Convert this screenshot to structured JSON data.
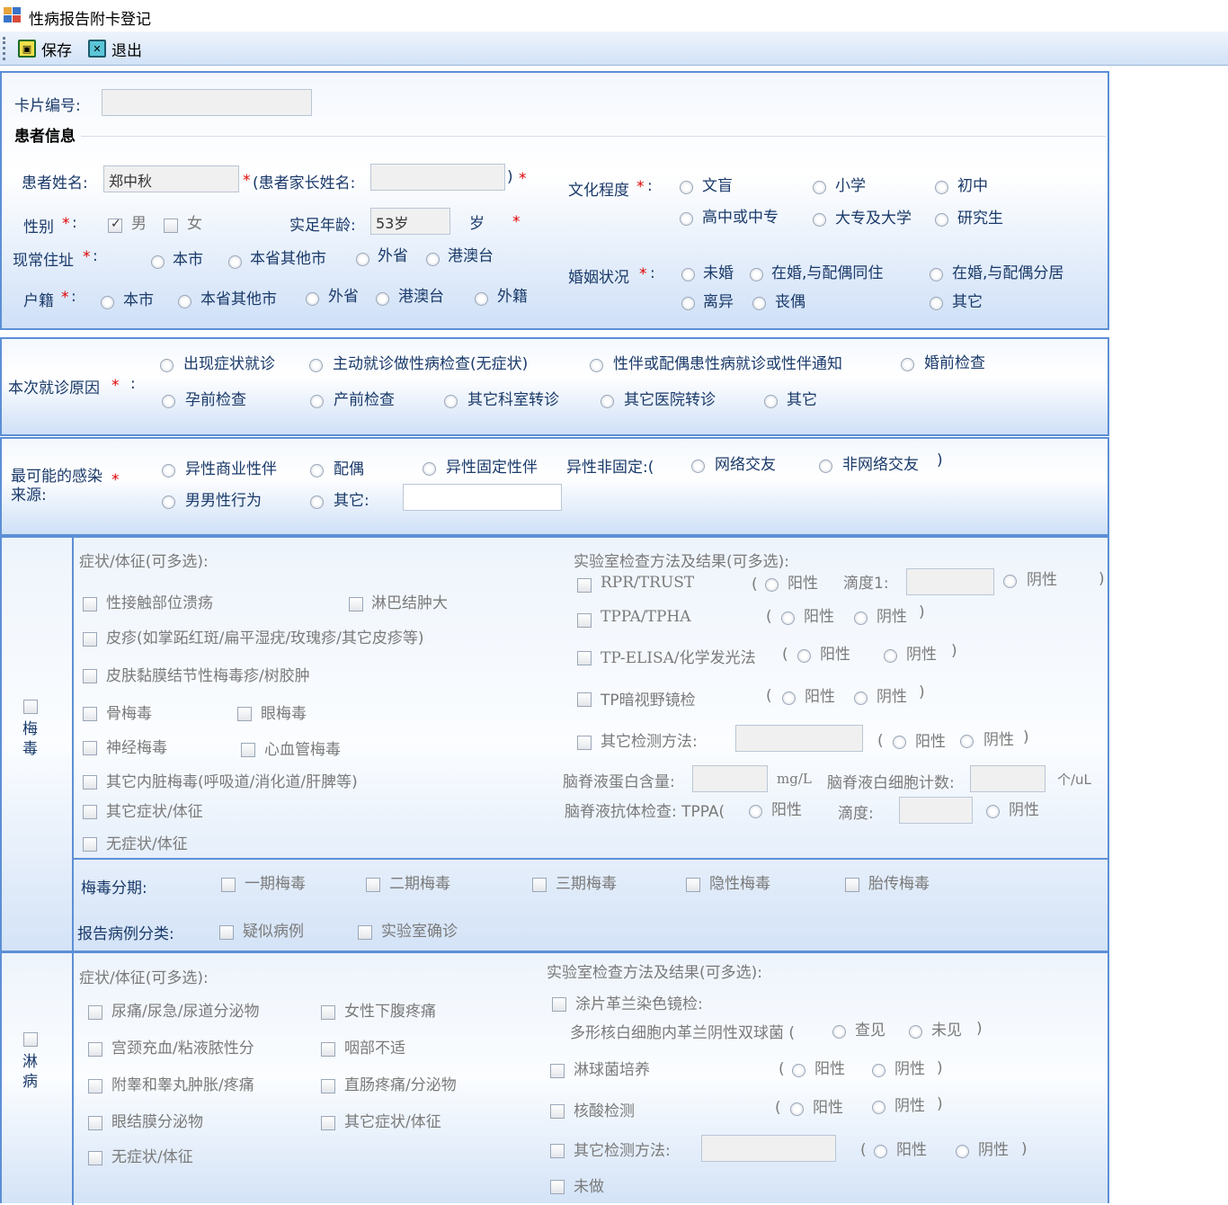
{
  "window": {
    "title": "性病报告附卡登记"
  },
  "toolbar": {
    "save": "保存",
    "exit": "退出"
  },
  "card": {
    "label": "卡片编号:",
    "value": ""
  },
  "patient": {
    "section": "患者信息",
    "name_label": "患者姓名:",
    "name_value": "郑中秋",
    "star": "*",
    "parent_label": "(患者家长姓名:",
    "parent_value": "",
    "paren_close": ")",
    "sex_label": "性别",
    "sex_male": "男",
    "sex_female": "女",
    "age_label": "实足年龄:",
    "age_value": "53岁",
    "age_unit": "岁",
    "edu_label": "文化程度",
    "colon": ":",
    "edu_opts": [
      "文盲",
      "小学",
      "初中",
      "高中或中专",
      "大专及大学",
      "研究生"
    ],
    "addr_label": "现常住址",
    "addr_opts": [
      "本市",
      "本省其他市",
      "外省",
      "港澳台"
    ],
    "reg_label": "户籍",
    "reg_opts": [
      "本市",
      "本省其他市",
      "外省",
      "港澳台",
      "外籍"
    ],
    "marry_label": "婚姻状况",
    "marry_opts": [
      "未婚",
      "在婚,与配偶同住",
      "在婚,与配偶分居",
      "离异",
      "丧偶",
      "其它"
    ]
  },
  "visit": {
    "label": "本次就诊原因",
    "star": "*",
    "colon": ":",
    "opts": [
      "出现症状就诊",
      "主动就诊做性病检查(无症状)",
      "性伴或配偶患性病就诊或性伴通知",
      "婚前检查",
      "孕前检查",
      "产前检查",
      "其它科室转诊",
      "其它医院转诊",
      "其它"
    ]
  },
  "source": {
    "label1": "最可能的感染",
    "label2": "来源:",
    "star": "*",
    "opts": [
      "异性商业性伴",
      "配偶",
      "异性固定性伴",
      "男男性行为",
      "其它:"
    ],
    "nonfixed": "异性非固定:(",
    "net": "网络交友",
    "nonnet": "非网络交友",
    "close": ")",
    "other_value": ""
  },
  "syphilis": {
    "title": "梅毒",
    "sym_title": "症状/体征(可多选):",
    "sym": [
      "性接触部位溃疡",
      "淋巴结肿大",
      "皮疹(如掌跖红斑/扁平湿疣/玫瑰疹/其它皮疹等)",
      "皮肤黏膜结节性梅毒疹/树胶肿",
      "骨梅毒",
      "眼梅毒",
      "神经梅毒",
      "心血管梅毒",
      "其它内脏梅毒(呼吸道/消化道/肝脾等)",
      "其它症状/体征",
      "无症状/体征"
    ],
    "lab_title": "实验室检查方法及结果(可多选):",
    "rpr": "RPR/TRUST",
    "tppa": "TPPA/TPHA",
    "elisa": "TP-ELISA/化学发光法",
    "dark": "TP暗视野镜检",
    "other": "其它检测方法:",
    "pos": "阳性",
    "neg": "阴性",
    "titer1": "滴度1:",
    "lp": "(",
    "rp": ")",
    "csf_protein": "脑脊液蛋白含量:",
    "mgl": "mg/L",
    "csf_wbc": "脑脊液白细胞计数:",
    "per_ul": "个/uL",
    "csf_ab": "脑脊液抗体检查: TPPA(",
    "titer": "滴度:",
    "stage_label": "梅毒分期:",
    "stages": [
      "一期梅毒",
      "二期梅毒",
      "三期梅毒",
      "隐性梅毒",
      "胎传梅毒"
    ],
    "class_label": "报告病例分类:",
    "classes": [
      "疑似病例",
      "实验室确诊"
    ]
  },
  "gonorrhea": {
    "title": "淋病",
    "sym_title": "症状/体征(可多选):",
    "sym": [
      "尿痛/尿急/尿道分泌物",
      "女性下腹疼痛",
      "宫颈充血/粘液脓性分",
      "咽部不适",
      "附睾和睾丸肿胀/疼痛",
      "直肠疼痛/分泌物",
      "眼结膜分泌物",
      "其它症状/体征",
      "无症状/体征"
    ],
    "lab_title": "实验室检查方法及结果(可多选):",
    "smear": "涂片革兰染色镜检:",
    "smear_sub": "多形核白细胞内革兰阴性双球菌 (",
    "seen": "查见",
    "unseen": "未见",
    "culture": "淋球菌培养",
    "nucleic": "核酸检测",
    "other": "其它检测方法:",
    "notdone": "未做",
    "pos": "阳性",
    "neg": "阴性",
    "lp": "(",
    "rp": ")"
  },
  "colors": {
    "border": "#5c8fd6",
    "label": "#1a3a6a",
    "star": "#e00000",
    "gray": "#7a7a7a"
  }
}
